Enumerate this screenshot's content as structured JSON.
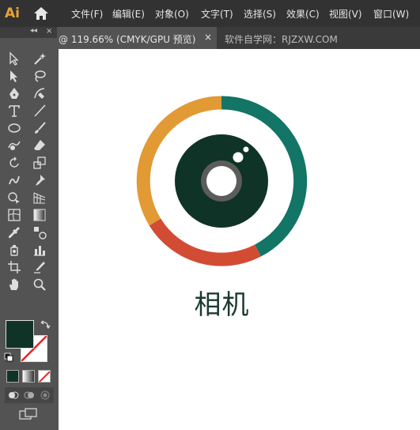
{
  "app": {
    "logo_text": "Ai"
  },
  "menu": [
    "文件(F)",
    "编辑(E)",
    "对象(O)",
    "文字(T)",
    "选择(S)",
    "效果(C)",
    "视图(V)",
    "窗口(W)"
  ],
  "tabs": {
    "active": "@ 119.66% (CMYK/GPU 预览)",
    "close": "×",
    "other": "软件自学网：RJZXW.COM"
  },
  "panel": {
    "collapse": "◂◂",
    "close": "×"
  },
  "canvas": {
    "title": "相机"
  },
  "colors": {
    "teal": "#127566",
    "orange": "#e29a35",
    "red": "#d24c33",
    "dark": "#103327",
    "lens_ring": "#5b5d5a",
    "fill": "#103327"
  }
}
